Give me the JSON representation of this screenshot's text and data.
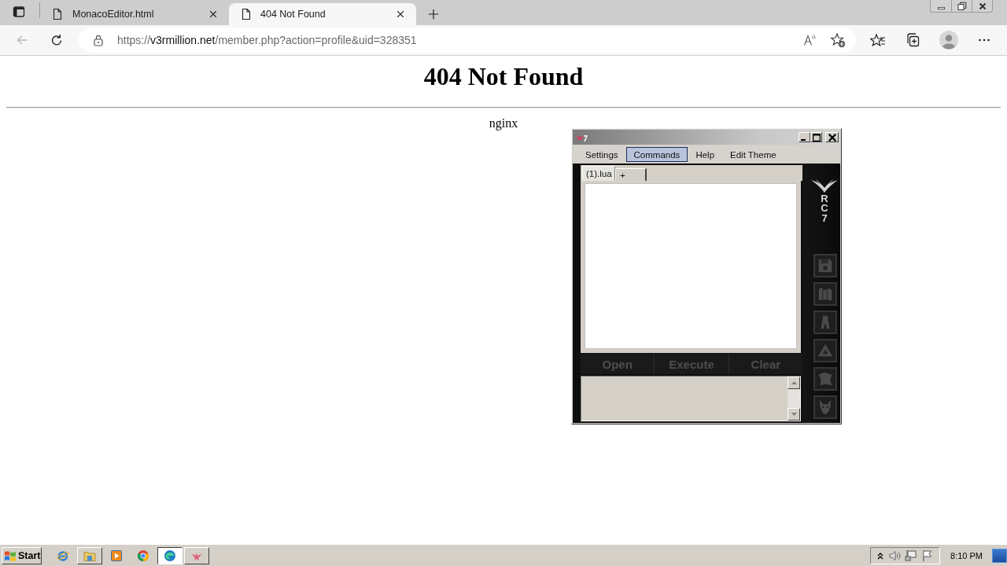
{
  "browser": {
    "tabs": [
      {
        "title": "MonacoEditor.html",
        "selected": false
      },
      {
        "title": "404 Not Found",
        "selected": true
      }
    ],
    "address": {
      "scheme": "https://",
      "host": "v3rmillion.net",
      "path": "/member.php?action=profile&uid=328351"
    }
  },
  "page": {
    "heading": "404 Not Found",
    "footer": "nginx"
  },
  "app_window": {
    "menu": [
      {
        "label": "Settings",
        "selected": false
      },
      {
        "label": "Commands",
        "selected": true
      },
      {
        "label": "Help",
        "selected": false
      },
      {
        "label": "Edit Theme",
        "selected": false
      }
    ],
    "editor_tabs": [
      {
        "label": "(1).lua",
        "selected": true
      },
      {
        "label": "+",
        "selected": false
      }
    ],
    "actions": [
      "Open",
      "Execute",
      "Clear"
    ],
    "logo_text": "RC7"
  },
  "taskbar": {
    "start": "Start",
    "apps": [
      {
        "kind": "globe",
        "running": false,
        "selected": false
      },
      {
        "kind": "folder",
        "running": true,
        "selected": false
      },
      {
        "kind": "player",
        "running": false,
        "selected": false
      },
      {
        "kind": "wheel",
        "running": false,
        "selected": false
      },
      {
        "kind": "wave",
        "running": true,
        "selected": true
      },
      {
        "kind": "bird",
        "running": true,
        "selected": false
      }
    ],
    "clock": "8:10 PM"
  }
}
